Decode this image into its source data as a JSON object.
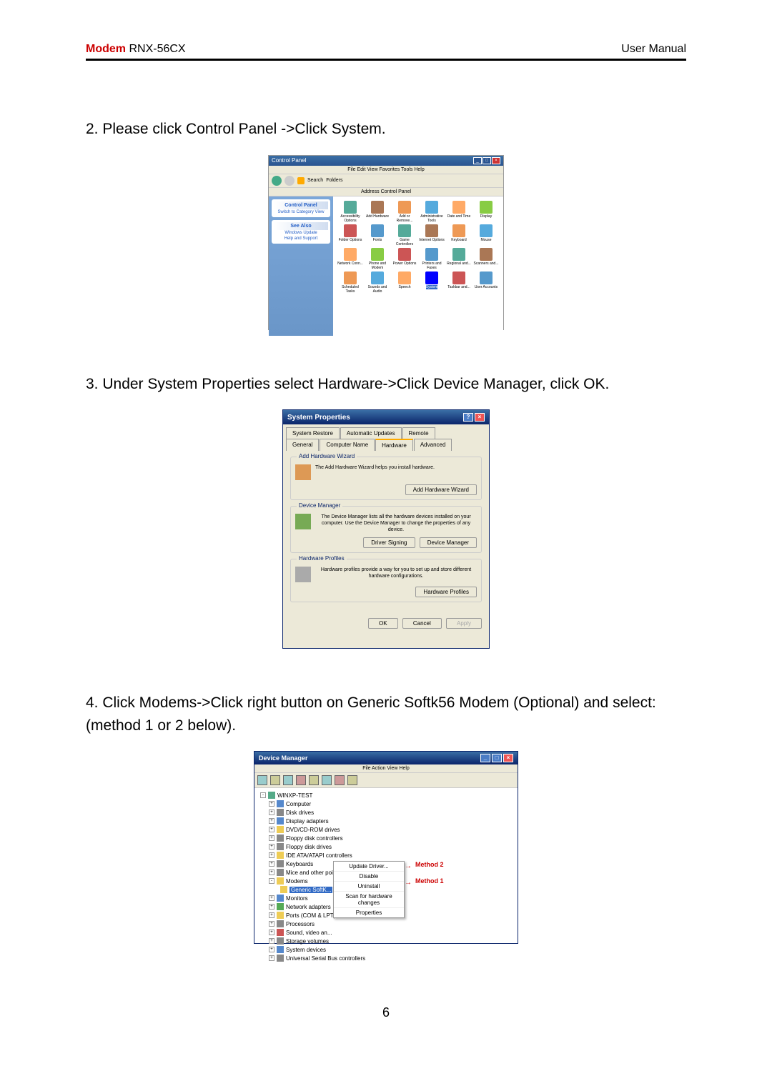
{
  "header": {
    "modem": "Modem",
    "model": "RNX-56CX",
    "right": "User  Manual"
  },
  "step2": {
    "text": "2.    Please click Control Panel ->Click System."
  },
  "controlPanel": {
    "title": "Control Panel",
    "menu": "File  Edit  View  Favorites  Tools  Help",
    "toolbar": {
      "back": "Back",
      "search": "Search",
      "folders": "Folders"
    },
    "address": "Address",
    "sidebar": {
      "header1": "Control Panel",
      "item1": "Switch to Category View",
      "header2": "See Also",
      "item2": "Windows Update",
      "item3": "Help and Support"
    },
    "icons": [
      "Accessibility Options",
      "Add Hardware",
      "Add or Remove...",
      "Administrative Tools",
      "Date and Time",
      "Display",
      "Folder Options",
      "Fonts",
      "Game Controllers",
      "Internet Options",
      "Keyboard",
      "Mouse",
      "Network Conn...",
      "Phone and Modem",
      "Power Options",
      "Printers and Faxes",
      "Regional and...",
      "Scanners and...",
      "Scheduled Tasks",
      "Sounds and Audio",
      "Speech",
      "System",
      "Taskbar and...",
      "User Accounts"
    ]
  },
  "step3": {
    "text": "3.    Under System Properties select Hardware->Click Device Manager, click OK."
  },
  "systemProperties": {
    "title": "System Properties",
    "tabs": {
      "row1": [
        "System Restore",
        "Automatic Updates",
        "Remote"
      ],
      "row2": [
        "General",
        "Computer Name",
        "Hardware",
        "Advanced"
      ]
    },
    "sections": {
      "addHardware": {
        "title": "Add Hardware Wizard",
        "text": "The Add Hardware Wizard helps you install hardware.",
        "button": "Add Hardware Wizard"
      },
      "deviceManager": {
        "title": "Device Manager",
        "text": "The Device Manager lists all the hardware devices installed on your computer. Use the Device Manager to change the properties of any device.",
        "button1": "Driver Signing",
        "button2": "Device Manager"
      },
      "hardwareProfiles": {
        "title": "Hardware Profiles",
        "text": "Hardware profiles provide a way for you to set up and store different hardware configurations.",
        "button": "Hardware Profiles"
      }
    },
    "footer": {
      "ok": "OK",
      "cancel": "Cancel",
      "apply": "Apply"
    }
  },
  "step4": {
    "text": "4.    Click Modems->Click right button on Generic Softk56 Modem (Optional) and select: (method 1 or 2 below)."
  },
  "deviceManager": {
    "title": "Device Manager",
    "menu": "File   Action   View   Help",
    "tree": {
      "root": "WINXP-TEST",
      "items": [
        "Computer",
        "Disk drives",
        "Display adapters",
        "DVD/CD-ROM drives",
        "Floppy disk controllers",
        "Floppy disk drives",
        "IDE ATA/ATAPI controllers",
        "Keyboards",
        "Mice and other pointing devices",
        "Modems",
        "Monitors",
        "Network adapters",
        "Ports (COM & LPT)",
        "Processors",
        "Sound, video an...",
        "Storage volumes",
        "System devices",
        "Universal Serial Bus controllers"
      ],
      "selected": "Generic SoftK..."
    },
    "context": [
      "Update Driver...",
      "Disable",
      "Uninstall",
      "Scan for hardware changes",
      "Properties"
    ],
    "annotations": {
      "method1": "Method 1",
      "method2": "Method 2"
    }
  },
  "pageNumber": "6"
}
